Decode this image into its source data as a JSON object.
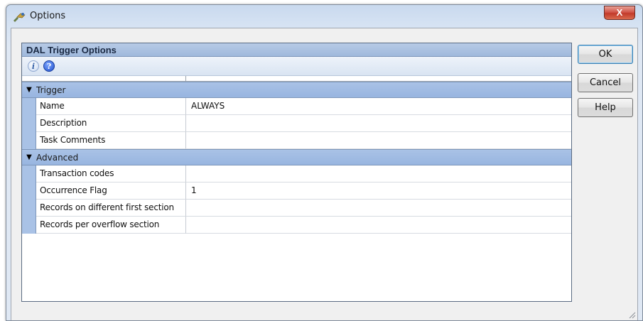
{
  "window": {
    "title": "Options",
    "close_label": "X"
  },
  "panel": {
    "header": "DAL Trigger Options",
    "toolbar": {
      "info_icon": "info-icon",
      "help_icon": "help-icon"
    }
  },
  "grid": {
    "categories": [
      {
        "label": "Trigger",
        "rows": [
          {
            "name": "Name",
            "value": "ALWAYS"
          },
          {
            "name": "Description",
            "value": ""
          },
          {
            "name": "Task Comments",
            "value": ""
          }
        ]
      },
      {
        "label": "Advanced",
        "rows": [
          {
            "name": "Transaction codes",
            "value": ""
          },
          {
            "name": "Occurrence Flag",
            "value": "1"
          },
          {
            "name": "Records on different first section",
            "value": ""
          },
          {
            "name": "Records per overflow section",
            "value": ""
          }
        ]
      }
    ]
  },
  "buttons": {
    "ok": "OK",
    "cancel": "Cancel",
    "help": "Help"
  },
  "colors": {
    "category_band": "#9fb9dc",
    "close_red": "#c23a2a"
  }
}
